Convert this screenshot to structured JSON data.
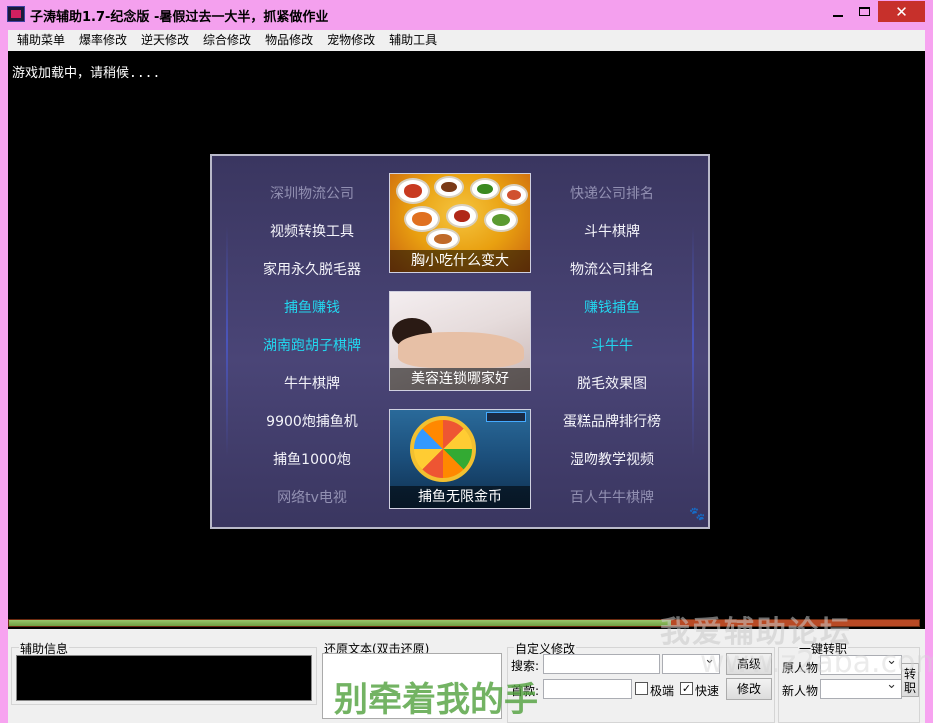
{
  "window": {
    "title": "子涛辅助1.7-纪念版 -暑假过去一大半，抓紧做作业",
    "close_glyph": "✕"
  },
  "menu": [
    "辅助菜单",
    "爆率修改",
    "逆天修改",
    "综合修改",
    "物品修改",
    "宠物修改",
    "辅助工具"
  ],
  "console": {
    "loading_text": "游戏加载中，请稍候...."
  },
  "ad_panel": {
    "left_links": [
      {
        "text": "深圳物流公司",
        "tone": "dim"
      },
      {
        "text": "视频转换工具",
        "tone": "white"
      },
      {
        "text": "家用永久脱毛器",
        "tone": "white"
      },
      {
        "text": "捕鱼赚钱",
        "tone": "cyan"
      },
      {
        "text": "湖南跑胡子棋牌",
        "tone": "cyan"
      },
      {
        "text": "牛牛棋牌",
        "tone": "white"
      },
      {
        "text": "9900炮捕鱼机",
        "tone": "white"
      },
      {
        "text": "捕鱼1000炮",
        "tone": "white"
      },
      {
        "text": "网络tv电视",
        "tone": "dim"
      }
    ],
    "right_links": [
      {
        "text": "快递公司排名",
        "tone": "dim"
      },
      {
        "text": "斗牛棋牌",
        "tone": "white"
      },
      {
        "text": "物流公司排名",
        "tone": "white"
      },
      {
        "text": "赚钱捕鱼",
        "tone": "cyan"
      },
      {
        "text": "斗牛牛",
        "tone": "cyan"
      },
      {
        "text": "脱毛效果图",
        "tone": "white"
      },
      {
        "text": "蛋糕品牌排行榜",
        "tone": "white"
      },
      {
        "text": "湿吻教学视频",
        "tone": "white"
      },
      {
        "text": "百人牛牛棋牌",
        "tone": "dim"
      }
    ],
    "thumbnails": [
      {
        "caption": "胸小吃什么变大"
      },
      {
        "caption": "美容连锁哪家好"
      },
      {
        "caption": "捕鱼无限金币"
      }
    ],
    "colors": {
      "dim": "#9290b2",
      "white": "#f4f4fa",
      "cyan": "#22d7ef"
    }
  },
  "progress": {
    "fraction": 0.728
  },
  "bottom": {
    "aux_info_label": "辅助信息",
    "restore_label": "还原文本(双击还原)",
    "custom_label": "自定义修改",
    "search_label": "搜索:",
    "first_label": "首款:",
    "advanced_button": "高级",
    "modify_button": "修改",
    "extreme_label": "极端",
    "extreme_checked": false,
    "fast_label": "快速",
    "fast_checked": true,
    "job_label": "一键转职",
    "original_char_label": "原人物",
    "new_char_label": "新人物",
    "transfer_button": "转职"
  },
  "watermarks": {
    "forum": "我爱辅助论坛",
    "url": "www.z2aba.com",
    "handwriting": "别牵着我的手"
  }
}
